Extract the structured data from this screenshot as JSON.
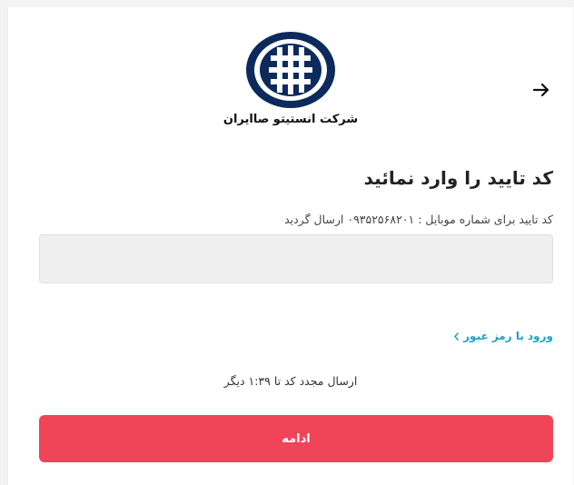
{
  "header": {
    "back_icon": "arrow-right-icon",
    "company_name": "شرکت انستیتو صاایران"
  },
  "form": {
    "title": "کد تایید را وارد نمائید",
    "subtitle": "کد تایید برای شماره موبایل : ۰۹۳۵۲۵۶۸۲۰۱ ارسال گردید",
    "code_value": "",
    "password_login_label": "ورود با رمز عبور",
    "password_login_icon": "chevron-left-icon",
    "resend_text": "ارسال مجدد کد تا ۱:۳۹ دیگر",
    "continue_label": "ادامه"
  },
  "colors": {
    "primary_button": "#f04458",
    "link": "#1aa3c4",
    "logo": "#0c2a5c"
  }
}
